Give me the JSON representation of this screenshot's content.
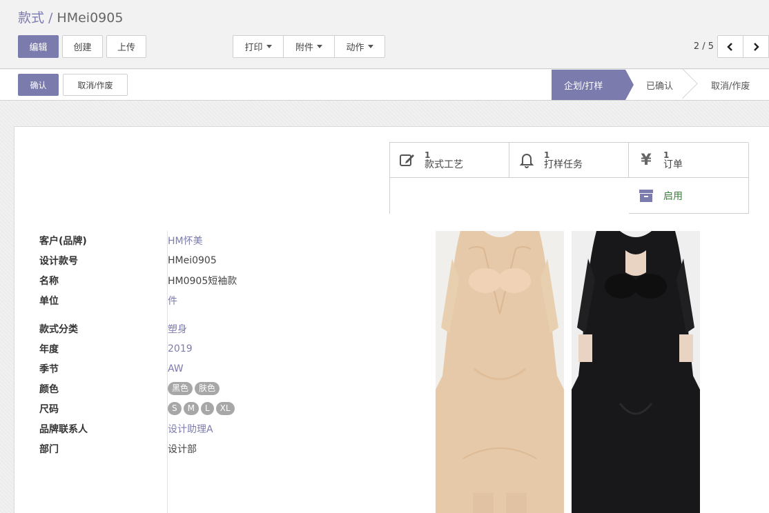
{
  "breadcrumb": {
    "parent": "款式",
    "separator": "/",
    "current": "HMei0905"
  },
  "toolbar": {
    "edit": "编辑",
    "create": "创建",
    "upload": "上传"
  },
  "dropdowns": {
    "print": "打印",
    "attachment": "附件",
    "action": "动作"
  },
  "pager": {
    "value": "2 / 5"
  },
  "statusbar": {
    "confirm": "确认",
    "cancel": "取消/作废",
    "steps": [
      "企划/打样",
      "已确认",
      "取消/作废"
    ],
    "active_step": "企划/打样"
  },
  "smart_buttons": {
    "style_craft": {
      "count": "1",
      "label": "款式工艺",
      "icon": "edit-icon"
    },
    "sample_task": {
      "count": "1",
      "label": "打样任务",
      "icon": "bell-icon"
    },
    "order": {
      "count": "1",
      "label": "订单",
      "icon": "yen-icon",
      "glyph": "¥"
    },
    "active": {
      "label": "启用",
      "icon": "archive-icon"
    }
  },
  "fields": {
    "customer": {
      "label": "客户(品牌)",
      "value": "HM怀美"
    },
    "design_no": {
      "label": "设计款号",
      "value": "HMei0905"
    },
    "name": {
      "label": "名称",
      "value": "HM0905短袖款"
    },
    "unit": {
      "label": "单位",
      "value": "件"
    },
    "category": {
      "label": "款式分类",
      "value": "塑身"
    },
    "year": {
      "label": "年度",
      "value": "2019"
    },
    "season": {
      "label": "季节",
      "value": "AW"
    },
    "color": {
      "label": "颜色",
      "tags": [
        "黑色",
        "肤色"
      ]
    },
    "size": {
      "label": "尺码",
      "tags": [
        "S",
        "M",
        "L",
        "XL"
      ]
    },
    "contact": {
      "label": "品牌联系人",
      "value": "设计助理A"
    },
    "department": {
      "label": "部门",
      "value": "设计部"
    }
  },
  "colors": {
    "primary": "#7c7bad",
    "tag_bg": "#a7a7a7",
    "active_text": "#3c7d3c"
  }
}
